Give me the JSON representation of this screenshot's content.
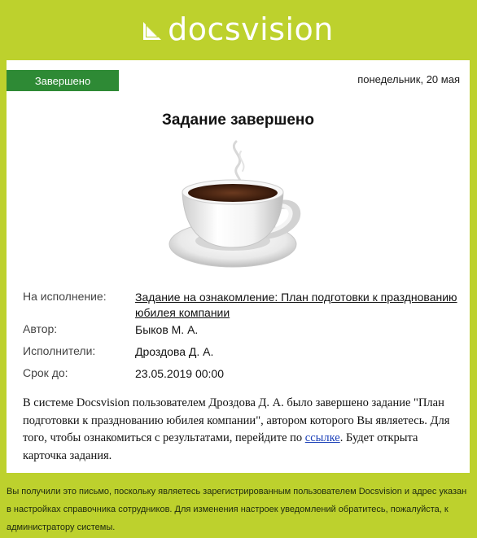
{
  "logo": {
    "text": "docsvision"
  },
  "status_badge": "Завершено",
  "date": "понедельник, 20 мая",
  "title": "Задание завершено",
  "info": {
    "task_label": "На исполнение:",
    "task_link": "Задание на ознакомление: План подготовки к празднованию юбилея компании",
    "author_label": "Автор:",
    "author_value": "Быков М. А.",
    "performers_label": "Исполнители:",
    "performers_value": "Дроздова Д. А.",
    "deadline_label": "Срок до:",
    "deadline_value": "23.05.2019 00:00"
  },
  "message": {
    "text_before_link": "В системе Docsvision пользователем Дроздова Д. А. было завершено задание \"План подготовки к празднованию юбилея компании\", автором которого Вы являетесь. Для того, чтобы ознакомиться с результатами, перейдите по ",
    "link_text": "ссылке",
    "text_after_link": ". Будет открыта карточка задания."
  },
  "footer": "Вы получили это письмо, поскольку являетесь зарегистрированным пользователем Docsvision и адрес указан в настройках справочника сотрудников. Для изменения настроек уведомлений обратитесь, пожалуйста, к администратору системы.",
  "colors": {
    "background": "#bdd12d",
    "badge": "#2e8a35",
    "link": "#1a3fb8"
  },
  "icons": [
    "docsvision-logo-icon",
    "coffee-cup-icon"
  ]
}
